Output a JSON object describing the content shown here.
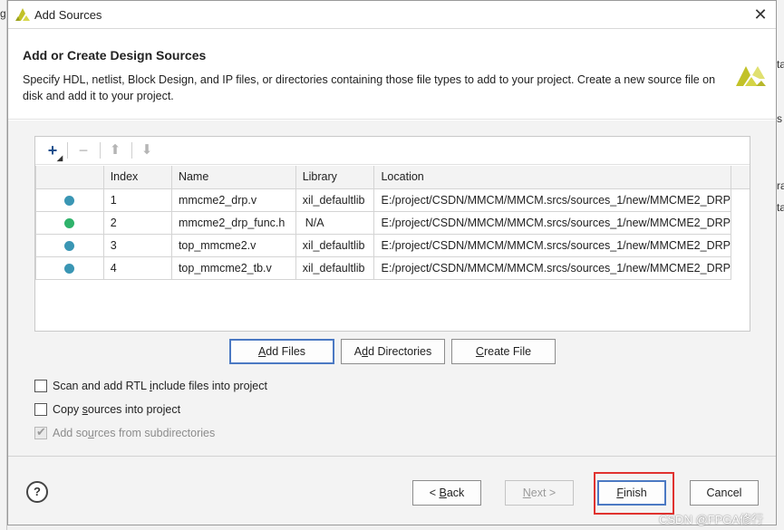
{
  "background": {
    "left_fragment": "g",
    "right_fragments": [
      "ta",
      "s",
      "ra",
      "ta"
    ]
  },
  "window": {
    "title": "Add Sources"
  },
  "header": {
    "title": "Add or Create Design Sources",
    "description": "Specify HDL, netlist, Block Design, and IP files, or directories containing those file types to add to your project. Create a new source file on disk and add it to your project."
  },
  "toolbar": {
    "add_icon": "plus-icon",
    "remove_icon": "minus-icon",
    "up_icon": "arrow-up-icon",
    "down_icon": "arrow-down-icon"
  },
  "table": {
    "columns": [
      "",
      "Index",
      "Name",
      "Library",
      "Location"
    ],
    "rows": [
      {
        "dot_color": "#3a96b4",
        "index": "1",
        "name": "mmcme2_drp.v",
        "library": "xil_defaultlib",
        "location": "E:/project/CSDN/MMCM/MMCM.srcs/sources_1/new/MMCME2_DRP"
      },
      {
        "dot_color": "#2fb36b",
        "index": "2",
        "name": "mmcme2_drp_func.h",
        "library": "N/A",
        "location": "E:/project/CSDN/MMCM/MMCM.srcs/sources_1/new/MMCME2_DRP"
      },
      {
        "dot_color": "#3a96b4",
        "index": "3",
        "name": "top_mmcme2.v",
        "library": "xil_defaultlib",
        "location": "E:/project/CSDN/MMCM/MMCM.srcs/sources_1/new/MMCME2_DRP"
      },
      {
        "dot_color": "#3a96b4",
        "index": "4",
        "name": "top_mmcme2_tb.v",
        "library": "xil_defaultlib",
        "location": "E:/project/CSDN/MMCM/MMCM.srcs/sources_1/new/MMCME2_DRP"
      }
    ]
  },
  "actions": {
    "add_files": {
      "pre": "",
      "key": "A",
      "post": "dd Files"
    },
    "add_directories": {
      "pre": "A",
      "key": "d",
      "post": "d Directories"
    },
    "create_file": {
      "pre": "",
      "key": "C",
      "post": "reate File"
    }
  },
  "options": {
    "scan_rtl": {
      "pre": "Scan and add RTL ",
      "key": "i",
      "post": "nclude files into project",
      "checked": false
    },
    "copy_sources": {
      "pre": "Copy ",
      "key": "s",
      "post": "ources into project",
      "checked": false
    },
    "subdirectories": {
      "pre": "Add so",
      "key": "u",
      "post": "rces from subdirectories",
      "checked": true,
      "disabled": true
    }
  },
  "footer": {
    "help": "?",
    "back": {
      "pre": "< ",
      "key": "B",
      "post": "ack"
    },
    "next": {
      "pre": "",
      "key": "N",
      "post": "ext >"
    },
    "finish": {
      "pre": "",
      "key": "F",
      "post": "inish"
    },
    "cancel": "Cancel"
  },
  "watermark": "CSDN @FPGA修行",
  "colors": {
    "default_button_border": "#4b79c3",
    "highlight": "#e0322f",
    "logo": "#c2c228"
  }
}
